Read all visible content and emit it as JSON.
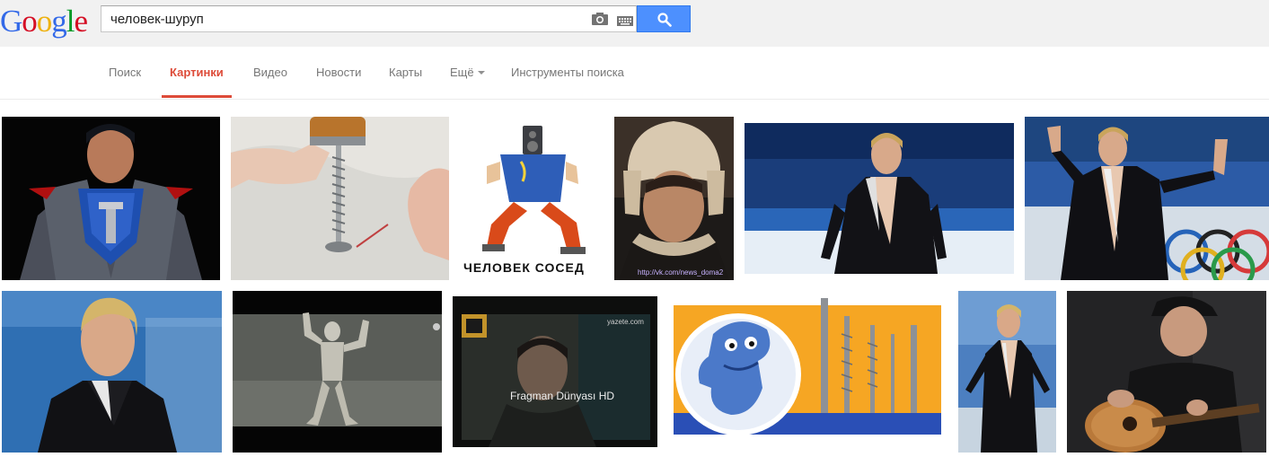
{
  "logo": {
    "letters": [
      "G",
      "o",
      "o",
      "g",
      "l",
      "e"
    ]
  },
  "search": {
    "value": "человек-шуруп"
  },
  "nav": {
    "items": [
      {
        "label": "Поиск"
      },
      {
        "label": "Картинки",
        "active": true
      },
      {
        "label": "Видео"
      },
      {
        "label": "Новости"
      },
      {
        "label": "Карты"
      },
      {
        "label": "Ещё"
      },
      {
        "label": "Инструменты поиска"
      }
    ]
  },
  "images": {
    "row1": [
      {
        "name": "superman-screw"
      },
      {
        "name": "battery-screw-magnet"
      },
      {
        "name": "cartoon-neighbor",
        "caption": "ЧЕЛОВЕК СОСЕД"
      },
      {
        "name": "fur-hat-man",
        "caption": "http://vk.com/news_doma2"
      },
      {
        "name": "skater-rink"
      },
      {
        "name": "skater-waving"
      }
    ],
    "row2": [
      {
        "name": "skater-portrait"
      },
      {
        "name": "3d-figure-pose"
      },
      {
        "name": "fragman-video",
        "caption": "Fragman Dünyası HD",
        "watermark": "yazete.com"
      },
      {
        "name": "dragon-screws"
      },
      {
        "name": "skater-standing"
      },
      {
        "name": "guitar-man"
      }
    ]
  },
  "colors": {
    "accent": "#dd4b39",
    "search_button": "#4d90fe",
    "topbar": "#f1f1f1"
  }
}
